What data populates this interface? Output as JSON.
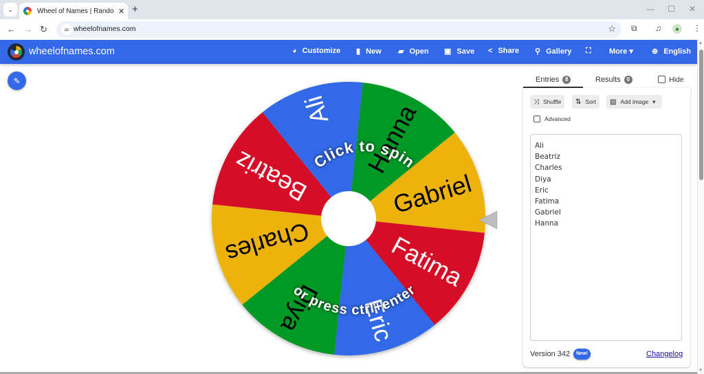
{
  "browser": {
    "tab_title": "Wheel of Names | Random nam",
    "tab_close": "✕",
    "new_tab": "+",
    "tab_search": "⌄",
    "url": "wheelofnames.com",
    "window_controls": {
      "minimize": "—",
      "maximize": "☐",
      "close": "✕"
    },
    "nav": {
      "back": "←",
      "forward": "→",
      "reload": "↻"
    },
    "bookmark_star": "☆",
    "extensions": "⧉",
    "media": "♫",
    "menu": "⋮",
    "tune": "⚌"
  },
  "header": {
    "site_name": "wheelofnames.com",
    "nav": [
      {
        "label": "Customize",
        "icon": "🎨"
      },
      {
        "label": "New",
        "icon": "▮"
      },
      {
        "label": "Open",
        "icon": "▰"
      },
      {
        "label": "Save",
        "icon": "▣"
      },
      {
        "label": "Share",
        "icon": "<"
      },
      {
        "label": "Gallery",
        "icon": "⚲"
      },
      {
        "label": "",
        "icon": "⛶"
      },
      {
        "label": "More ▾",
        "icon": ""
      },
      {
        "label": "English",
        "icon": "⊕"
      }
    ]
  },
  "edit_icon": "✎",
  "wheel": {
    "center_text_top": "Click to spin",
    "center_text_bottom": "or press ctrl+enter",
    "segments": [
      {
        "label": "Gabriel",
        "color": "#eeb211",
        "text_color": "#000000"
      },
      {
        "label": "Fatima",
        "color": "#d50f25",
        "text_color": "#ffffff"
      },
      {
        "label": "Eric",
        "color": "#3369e8",
        "text_color": "#ffffff"
      },
      {
        "label": "Diya",
        "color": "#009925",
        "text_color": "#000000"
      },
      {
        "label": "Charles",
        "color": "#eeb211",
        "text_color": "#000000"
      },
      {
        "label": "Beatriz",
        "color": "#d50f25",
        "text_color": "#ffffff"
      },
      {
        "label": "Ali",
        "color": "#3369e8",
        "text_color": "#ffffff"
      },
      {
        "label": "Hanna",
        "color": "#009925",
        "text_color": "#000000"
      }
    ],
    "pointer_color": "#bdbdbd"
  },
  "panel": {
    "tabs": [
      {
        "label": "Entries",
        "count": "8"
      },
      {
        "label": "Results",
        "count": "0"
      }
    ],
    "hide_label": "Hide",
    "buttons": {
      "shuffle": {
        "label": "Shuffle",
        "icon": "⤨"
      },
      "sort": {
        "label": "Sort",
        "icon": "⇅"
      },
      "add_image": {
        "label": "Add image",
        "icon": "▨",
        "caret": "▾"
      }
    },
    "advanced_label": "Advanced",
    "entries": [
      "Ali",
      "Beatriz",
      "Charles",
      "Diya",
      "Eric",
      "Fatima",
      "Gabriel",
      "Hanna"
    ],
    "version": "Version 342",
    "new_badge": "New!",
    "changelog": "Changelog"
  }
}
